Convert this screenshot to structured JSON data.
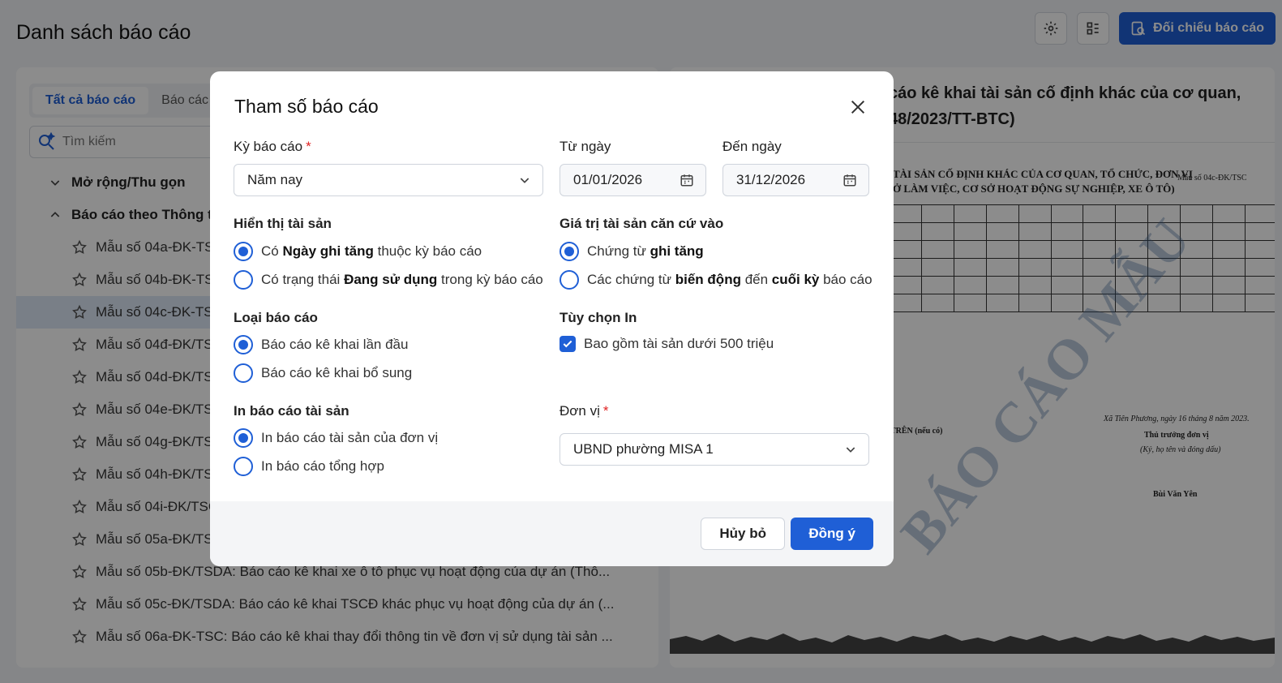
{
  "header": {
    "title": "Danh sách báo cáo",
    "compare_button": "Đối chiếu báo cáo"
  },
  "left": {
    "tabs": [
      {
        "label": "Tất cả báo cáo"
      },
      {
        "label": "Báo các"
      }
    ],
    "search_placeholder": "Tìm kiếm",
    "groups": {
      "expand": "Mở rộng/Thu gọn",
      "circular": "Báo cáo theo Thông tư"
    },
    "items": [
      "Mẫu số 04a-ĐK-TSC",
      "Mẫu số 04b-ĐK-TSC",
      "Mẫu số 04c-ĐK-TSC",
      "Mẫu số 04đ-ĐK/TSC",
      "Mẫu số 04d-ĐK/TSC",
      "Mẫu số 04e-ĐK/TSC",
      "Mẫu số 04g-ĐK/TSC",
      "Mẫu số 04h-ĐK/TSC",
      "Mẫu số 04i-ĐK/TSC",
      "Mẫu số 05a-ĐK/TSDA",
      "Mẫu số 05b-ĐK/TSDA: Báo cáo kê khai xe ô tô phục vụ hoạt động của dự án (Thô...",
      "Mẫu số 05c-ĐK/TSDA: Báo cáo kê khai TSCĐ khác phục vụ hoạt động của dự án (...",
      "Mẫu số 06a-ĐK-TSC: Báo cáo kê khai thay đổi thông tin về đơn vị sử dụng tài sản ..."
    ]
  },
  "preview": {
    "title": "cáo kê khai tài sản cố định khác của cơ quan, 48/2023/TT-BTC)",
    "form_code": "Mẫu số 04c-ĐK/TSC",
    "heading_line1": "TÀI SẢN CỐ ĐỊNH KHÁC CỦA CƠ QUAN, TỔ CHỨC, ĐƠN VỊ",
    "heading_line2": "Ở LÀM VIỆC, CƠ SỞ HOẠT ĐỘNG SỰ NGHIỆP, XE Ô TÔ)",
    "location_date": "Xã Tiên Phương, ngày 16 tháng 8 năm 2023.",
    "signer_title": "Thủ trưởng đơn vị",
    "signer_note": "(Ký, họ tên và đóng dấu)",
    "signer_name": "Bùi Văn Yên",
    "superior": "TRÊN (nếu có)",
    "watermark": "BÁO CÁO MẪU"
  },
  "modal": {
    "title": "Tham số báo cáo",
    "period": {
      "label": "Kỳ báo cáo",
      "value": "Năm nay"
    },
    "from": {
      "label": "Từ ngày",
      "value": "01/01/2026"
    },
    "to": {
      "label": "Đến ngày",
      "value": "31/12/2026"
    },
    "display": {
      "title": "Hiển thị tài sản",
      "opt1": {
        "pre": "Có ",
        "bold": "Ngày ghi tăng",
        "post": " thuộc kỳ báo cáo"
      },
      "opt2": {
        "pre": "Có trạng thái ",
        "bold": "Đang sử dụng",
        "post": " trong kỳ báo cáo"
      }
    },
    "value_basis": {
      "title": "Giá trị tài sản căn cứ vào",
      "opt1": {
        "pre": "Chứng từ ",
        "bold": "ghi tăng"
      },
      "opt2": {
        "pre": "Các chứng từ ",
        "bold1": "biến động",
        "mid": " đến ",
        "bold2": "cuối kỳ",
        "post": " báo cáo"
      }
    },
    "report_type": {
      "title": "Loại báo cáo",
      "opt1": "Báo cáo kê khai lần đầu",
      "opt2": "Báo cáo kê khai bổ sung"
    },
    "print_options": {
      "title": "Tùy chọn In",
      "checkbox": "Bao gồm tài sản dưới 500 triệu"
    },
    "print_report": {
      "title": "In báo cáo tài sản",
      "opt1": "In báo cáo tài sản của đơn vị",
      "opt2": "In báo cáo tổng hợp"
    },
    "unit": {
      "label": "Đơn vị",
      "value": "UBND phường MISA 1"
    },
    "cancel": "Hủy bỏ",
    "ok": "Đồng ý"
  }
}
